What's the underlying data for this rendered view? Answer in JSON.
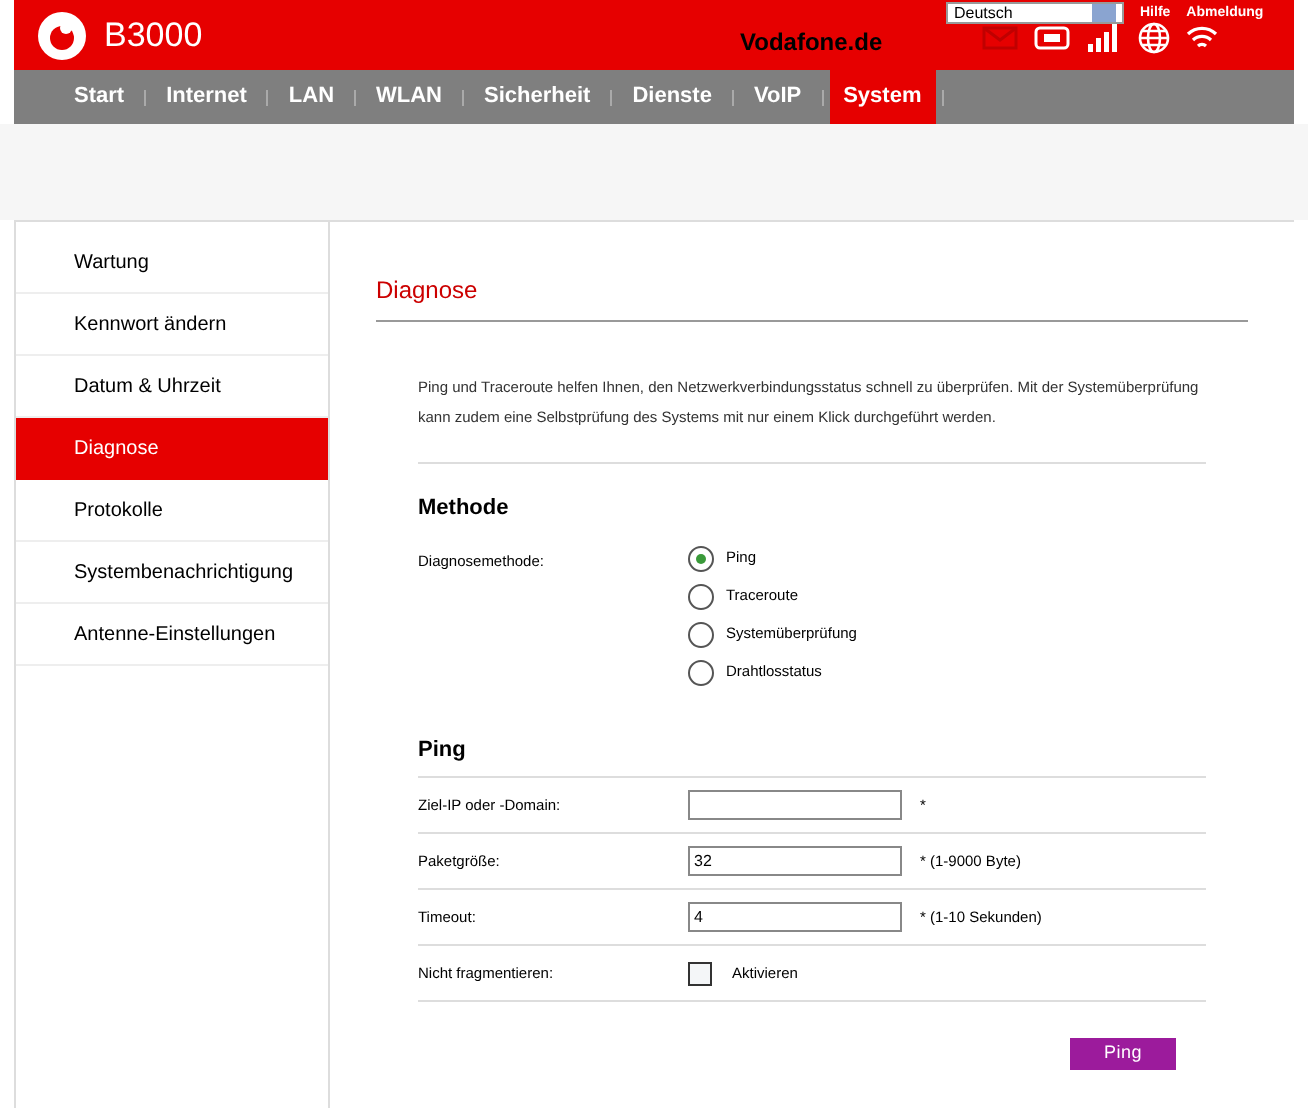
{
  "header": {
    "product": "B3000",
    "site": "Vodafone.de",
    "language": "Deutsch",
    "links": [
      "Hilfe",
      "Abmeldung"
    ]
  },
  "nav": [
    {
      "label": "Start",
      "selected": false
    },
    {
      "label": "Internet",
      "selected": false
    },
    {
      "label": "LAN",
      "selected": false
    },
    {
      "label": "WLAN",
      "selected": false
    },
    {
      "label": "Sicherheit",
      "selected": false
    },
    {
      "label": "Dienste",
      "selected": false
    },
    {
      "label": "VoIP",
      "selected": false
    },
    {
      "label": "System",
      "selected": true
    }
  ],
  "sidebar": {
    "items": [
      {
        "label": "Wartung",
        "selected": false
      },
      {
        "label": "Kennwort ändern",
        "selected": false
      },
      {
        "label": "Datum & Uhrzeit",
        "selected": false
      },
      {
        "label": "Diagnose",
        "selected": true
      },
      {
        "label": "Protokolle",
        "selected": false
      },
      {
        "label": "Systembenachrichtigung",
        "selected": false
      },
      {
        "label": "Antenne-Einstellungen",
        "selected": false
      }
    ]
  },
  "page": {
    "title": "Diagnose",
    "description": "Ping und Traceroute helfen Ihnen, den Netzwerkverbindungsstatus schnell zu überprüfen. Mit der Systemüberprüfung kann zudem eine Selbstprüfung des Systems mit nur einem Klick durchgeführt werden."
  },
  "method": {
    "heading": "Methode",
    "label": "Diagnosemethode:",
    "options": [
      {
        "label": "Ping",
        "selected": true
      },
      {
        "label": "Traceroute",
        "selected": false
      },
      {
        "label": "Systemüberprüfung",
        "selected": false
      },
      {
        "label": "Drahtlosstatus",
        "selected": false
      }
    ]
  },
  "ping": {
    "heading": "Ping",
    "fields": [
      {
        "kind": "text",
        "label": "Ziel-IP oder -Domain:",
        "hint": "*"
      },
      {
        "kind": "text",
        "label": "Paketgröße:",
        "value": "32",
        "hint": "* (1-9000 Byte)"
      },
      {
        "kind": "text",
        "label": "Timeout:",
        "value": "4",
        "hint": "* (1-10 Sekunden)"
      },
      {
        "kind": "checkbox",
        "label": "Nicht fragmentieren:",
        "checked": false,
        "option": "Aktivieren"
      }
    ],
    "button": "Ping"
  }
}
